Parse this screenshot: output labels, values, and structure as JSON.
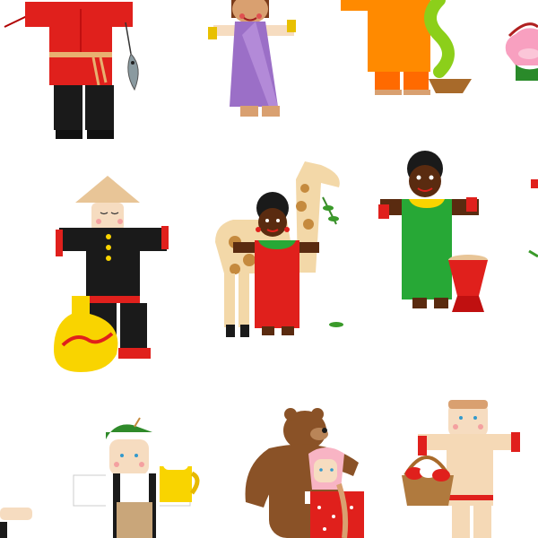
{
  "scene": {
    "background": "#ffffff",
    "description_tags": [
      "fisherman-russian",
      "indian-woman-sari",
      "orange-figure-snake",
      "lotus-basket",
      "chinese-man",
      "african-girl-giraffe",
      "african-man-drum",
      "bavarian-man-beer",
      "bear-and-girl",
      "slavic-boy-mushrooms"
    ]
  },
  "colors": {
    "skin_light": "#f6dcc0",
    "skin_dark": "#5a2b10",
    "skin_tan": "#d9a070",
    "red": "#e0201c",
    "black": "#1a1a1a",
    "purple": "#9b6fc7",
    "orange": "#ff8a00",
    "green": "#27a836",
    "yellow": "#f9d400",
    "giraffe": "#f3d8a8",
    "giraffe_spot": "#c58a3e",
    "bear": "#8a5227",
    "pink": "#f8b4c4",
    "tan_clothes": "#f5d9b6",
    "snake_green": "#8ccf1a"
  }
}
